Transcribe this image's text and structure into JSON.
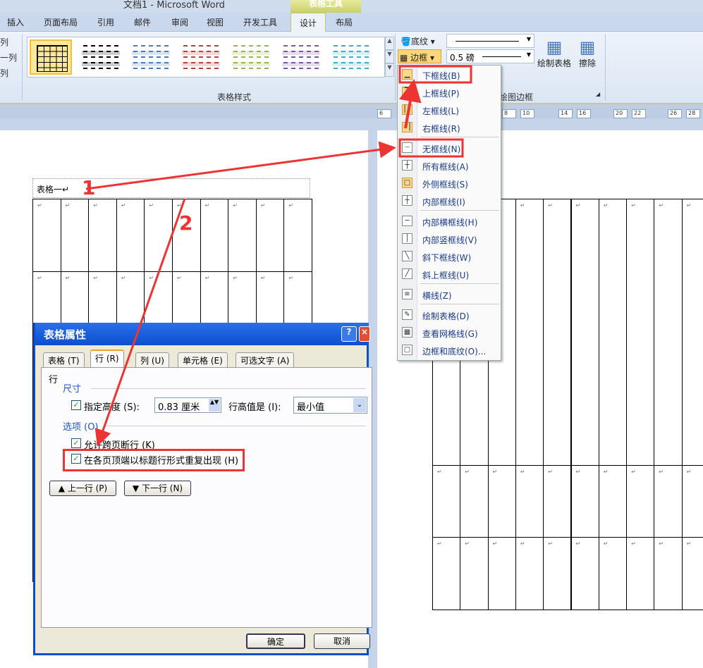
{
  "window": {
    "title": "文档1  -  Microsoft Word",
    "context_tab": "表格工具"
  },
  "tabs": [
    "插入",
    "页面布局",
    "引用",
    "邮件",
    "审阅",
    "视图",
    "开发工具",
    "设计",
    "布局"
  ],
  "selected_tab": "设计",
  "ribbon": {
    "left_partial": [
      "列",
      "一列",
      "列"
    ],
    "styles_group_label": "表格样式",
    "style_colors": [
      "#000000",
      "#000000",
      "#4a7cc0",
      "#c0403a",
      "#9ab54a",
      "#7a5aa0",
      "#3ab0c8"
    ],
    "shading_label": "底纹",
    "borders_label": "边框",
    "line_weight": "0.5 磅",
    "draw_table_label": "绘制表格",
    "eraser_label": "擦除",
    "draw_borders_group_label": "绘图边框"
  },
  "ruler": [
    "6",
    "8",
    "10",
    "14",
    "16",
    "20",
    "22",
    "26",
    "28"
  ],
  "document": {
    "caption": "表格一↵",
    "paragraph_mark": "↵"
  },
  "borders_menu": [
    {
      "label": "下框线(B)",
      "icon": "bottom-border-icon",
      "highlight": true
    },
    {
      "label": "上框线(P)",
      "icon": "top-border-icon"
    },
    {
      "label": "左框线(L)",
      "icon": "left-border-icon"
    },
    {
      "label": "右框线(R)",
      "icon": "right-border-icon"
    },
    {
      "label": "无框线(N)",
      "icon": "no-border-icon",
      "highlight": true
    },
    {
      "label": "所有框线(A)",
      "icon": "all-borders-icon"
    },
    {
      "label": "外侧框线(S)",
      "icon": "outside-borders-icon"
    },
    {
      "label": "内部框线(I)",
      "icon": "inside-borders-icon"
    },
    {
      "label": "内部横框线(H)",
      "icon": "inside-horizontal-border-icon"
    },
    {
      "label": "内部竖框线(V)",
      "icon": "inside-vertical-border-icon"
    },
    {
      "label": "斜下框线(W)",
      "icon": "diagonal-down-border-icon"
    },
    {
      "label": "斜上框线(U)",
      "icon": "diagonal-up-border-icon"
    },
    {
      "label": "横线(Z)",
      "icon": "horizontal-line-icon"
    },
    {
      "label": "绘制表格(D)",
      "icon": "draw-table-icon"
    },
    {
      "label": "查看网格线(G)",
      "icon": "view-gridlines-icon"
    },
    {
      "label": "边框和底纹(O)...",
      "icon": "borders-shading-icon"
    }
  ],
  "dialog": {
    "title": "表格属性",
    "tabs": [
      "表格 (T)",
      "行 (R)",
      "列 (U)",
      "单元格 (E)",
      "可选文字 (A)"
    ],
    "section": "行",
    "size_label": "尺寸",
    "specify_height": {
      "label": "指定高度 (S):",
      "checked": true,
      "value": "0.83 厘米"
    },
    "row_height_is": {
      "label": "行高值是 (I):",
      "value": "最小值"
    },
    "options_label": "选项 (O)",
    "allow_break": {
      "label": "允许跨页断行 (K)",
      "checked": true
    },
    "repeat_header": {
      "label": "在各页顶端以标题行形式重复出现 (H)",
      "checked": true
    },
    "prev_row": "上一行 (P)",
    "next_row": "下一行 (N)",
    "ok": "确定",
    "cancel": "取消",
    "help": "?",
    "close": "×"
  },
  "annotations": {
    "one": "1",
    "two": "2",
    "color": "#ee3333"
  }
}
